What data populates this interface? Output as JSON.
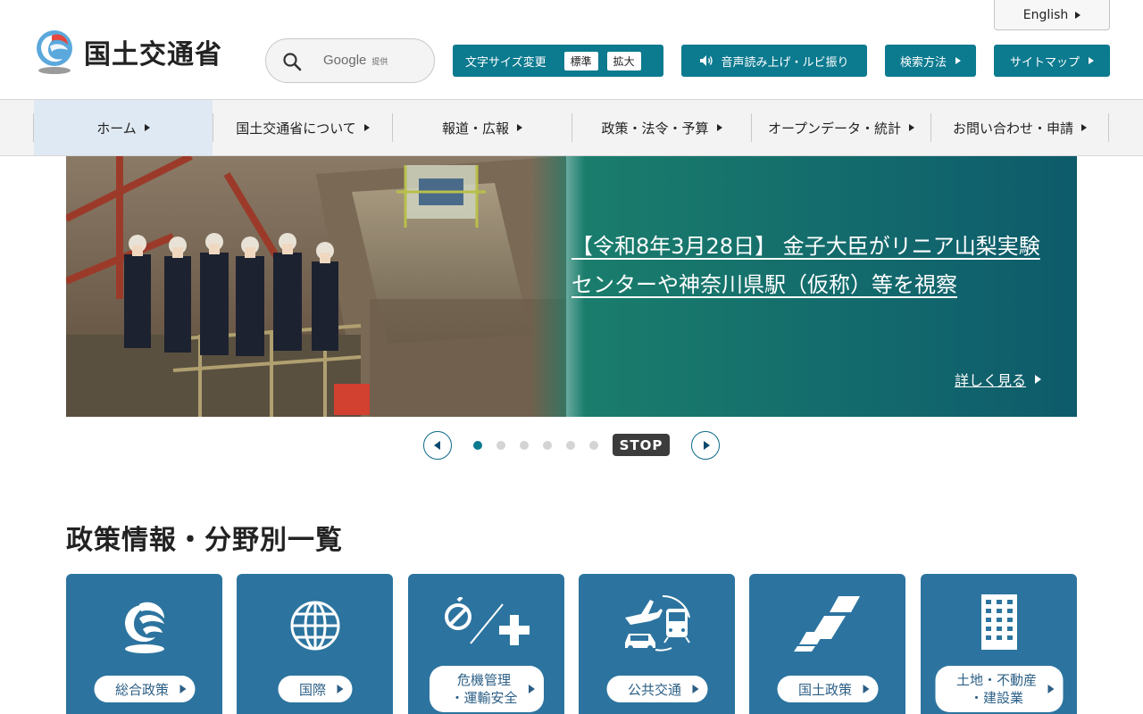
{
  "header": {
    "logo_text": "国土交通省",
    "search": {
      "brand": "Google",
      "brand_note": "提供",
      "placeholder": ""
    },
    "english_label": "English",
    "font_size": {
      "label": "文字サイズ変更",
      "standard": "標準",
      "large": "拡大"
    },
    "voice_label": "音声読み上げ・ルビ振り",
    "howto_label": "検索方法",
    "sitemap_label": "サイトマップ"
  },
  "nav": {
    "items": [
      {
        "label": "ホーム"
      },
      {
        "label": "国土交通省について"
      },
      {
        "label": "報道・広報"
      },
      {
        "label": "政策・法令・予算"
      },
      {
        "label": "オープンデータ・統計"
      },
      {
        "label": "お問い合わせ・申請"
      }
    ]
  },
  "hero": {
    "title": "【令和8年3月28日】 金子大臣がリニア山梨実験センターや神奈川県駅（仮称）等を視察",
    "more_label": "詳しく見る"
  },
  "carousel": {
    "stop_label": "STOP",
    "dots": 6,
    "active_index": 0
  },
  "section": {
    "title": "政策情報・分野別一覧",
    "cards": [
      {
        "label": "総合政策",
        "icon": "mlit-logo-icon"
      },
      {
        "label": "国際",
        "icon": "globe-icon"
      },
      {
        "label_line1": "危機管理",
        "label_line2": "・運輸安全",
        "icon": "safety-icon"
      },
      {
        "label": "公共交通",
        "icon": "transport-icon"
      },
      {
        "label": "国土政策",
        "icon": "land-policy-icon"
      },
      {
        "label_line1": "土地・不動産",
        "label_line2": "・建設業",
        "icon": "building-icon"
      }
    ]
  },
  "colors": {
    "teal_button": "#0c7a8f",
    "card_blue": "#2c749f",
    "nav_active": "#dfe9f3"
  }
}
